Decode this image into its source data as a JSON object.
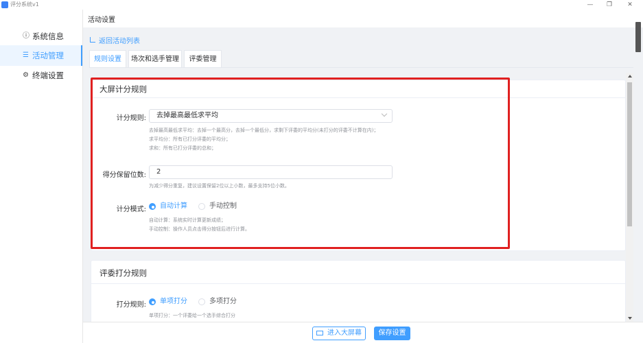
{
  "window": {
    "title": "评分系统v1",
    "minimize": "—",
    "restore": "❐",
    "close": "✕"
  },
  "sidebar": {
    "items": [
      {
        "label": "系统信息",
        "icon": "info-circle-icon",
        "glyph": "ⓘ",
        "active": false
      },
      {
        "label": "活动管理",
        "icon": "list-icon",
        "glyph": "☰",
        "active": true
      },
      {
        "label": "终端设置",
        "icon": "gear-icon",
        "glyph": "⚙",
        "active": false
      }
    ]
  },
  "header": {
    "title": "活动设置"
  },
  "back_link": {
    "label": "返回活动列表"
  },
  "tabs": [
    {
      "label": "规则设置",
      "active": true
    },
    {
      "label": "场次和选手管理",
      "active": false
    },
    {
      "label": "评委管理",
      "active": false
    }
  ],
  "big_screen_rules": {
    "title": "大屏计分规则",
    "scoring_rule": {
      "label": "计分规则:",
      "value": "去掉最高最低求平均",
      "hints": [
        "去掉最高最低求平均：去掉一个最高分，去掉一个最低分，求剩下评委的平均分(未打分的评委不计算在内)；",
        "求平均分：所有已打分评委的平均分；",
        "求和：所有已打分评委的总和；"
      ]
    },
    "decimal_places": {
      "label": "得分保留位数:",
      "value": "2",
      "hint": "为减少得分重复，建议设置保留2位以上小数，最多支持5位小数。"
    },
    "scoring_mode": {
      "label": "计分模式:",
      "options": [
        {
          "label": "自动计算",
          "checked": true
        },
        {
          "label": "手动控制",
          "checked": false
        }
      ],
      "hints": [
        "自动计算：系统实时计算更新成绩；",
        "手动控制：操作人员点击得分按钮后进行计算。"
      ]
    }
  },
  "judge_rules": {
    "title": "评委打分规则",
    "scoring_rule": {
      "label": "打分规则:",
      "options": [
        {
          "label": "单项打分",
          "checked": true
        },
        {
          "label": "多项打分",
          "checked": false
        }
      ],
      "hint": "单项打分：一个评委给一个选手综合打分"
    }
  },
  "footer": {
    "enter_screen_label": "进入大屏幕",
    "save_label": "保存设置"
  },
  "colors": {
    "primary": "#409eff",
    "highlight": "#e02020"
  }
}
